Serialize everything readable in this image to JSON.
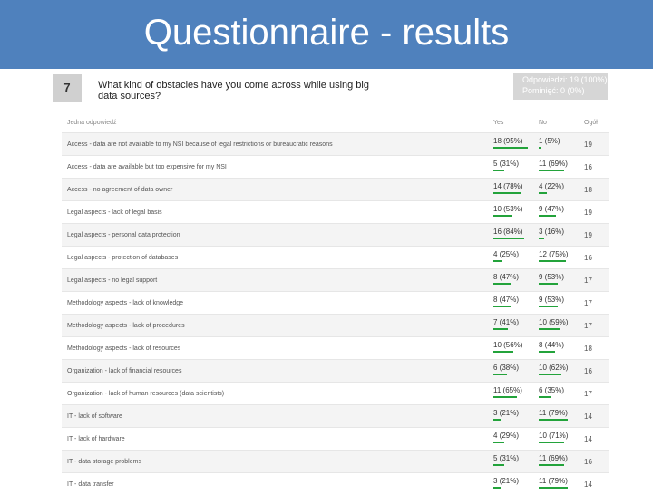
{
  "slide": {
    "title": "Questionnaire - results"
  },
  "question": {
    "number": "7",
    "text": "What kind of obstacles have you come across while using big data sources?",
    "stats_answered": "Odpowiedzi: 19 (100%)",
    "stats_skipped": "Pominięć: 0 (0%)"
  },
  "table": {
    "headers": [
      "Jedna odpowiedź",
      "Yes",
      "No",
      "Ogół"
    ],
    "rows": [
      {
        "label": "Access - data are not available to my NSI because of legal restrictions or bureaucratic reasons",
        "yes": "18 (95%)",
        "yes_frac": 0.95,
        "no": "1 (5%)",
        "no_frac": 0.05,
        "total": "19"
      },
      {
        "label": "Access - data are available but too expensive for my NSI",
        "yes": "5 (31%)",
        "yes_frac": 0.31,
        "no": "11 (69%)",
        "no_frac": 0.69,
        "total": "16"
      },
      {
        "label": "Access - no agreement of data owner",
        "yes": "14 (78%)",
        "yes_frac": 0.78,
        "no": "4 (22%)",
        "no_frac": 0.22,
        "total": "18"
      },
      {
        "label": "Legal aspects - lack of legal basis",
        "yes": "10 (53%)",
        "yes_frac": 0.53,
        "no": "9 (47%)",
        "no_frac": 0.47,
        "total": "19"
      },
      {
        "label": "Legal aspects - personal data protection",
        "yes": "16 (84%)",
        "yes_frac": 0.84,
        "no": "3 (16%)",
        "no_frac": 0.16,
        "total": "19"
      },
      {
        "label": "Legal aspects - protection of databases",
        "yes": "4 (25%)",
        "yes_frac": 0.25,
        "no": "12 (75%)",
        "no_frac": 0.75,
        "total": "16"
      },
      {
        "label": "Legal aspects - no legal support",
        "yes": "8 (47%)",
        "yes_frac": 0.47,
        "no": "9 (53%)",
        "no_frac": 0.53,
        "total": "17"
      },
      {
        "label": "Methodology aspects - lack of knowledge",
        "yes": "8 (47%)",
        "yes_frac": 0.47,
        "no": "9 (53%)",
        "no_frac": 0.53,
        "total": "17"
      },
      {
        "label": "Methodology aspects - lack of procedures",
        "yes": "7 (41%)",
        "yes_frac": 0.41,
        "no": "10 (59%)",
        "no_frac": 0.59,
        "total": "17"
      },
      {
        "label": "Methodology aspects - lack of resources",
        "yes": "10 (56%)",
        "yes_frac": 0.56,
        "no": "8 (44%)",
        "no_frac": 0.44,
        "total": "18"
      },
      {
        "label": "Organization - lack of financial resources",
        "yes": "6 (38%)",
        "yes_frac": 0.38,
        "no": "10 (62%)",
        "no_frac": 0.62,
        "total": "16"
      },
      {
        "label": "Organization - lack of human resources (data scientists)",
        "yes": "11 (65%)",
        "yes_frac": 0.65,
        "no": "6 (35%)",
        "no_frac": 0.35,
        "total": "17"
      },
      {
        "label": "IT - lack of software",
        "yes": "3 (21%)",
        "yes_frac": 0.21,
        "no": "11 (79%)",
        "no_frac": 0.79,
        "total": "14"
      },
      {
        "label": "IT - lack of hardware",
        "yes": "4 (29%)",
        "yes_frac": 0.29,
        "no": "10 (71%)",
        "no_frac": 0.71,
        "total": "14"
      },
      {
        "label": "IT - data storage problems",
        "yes": "5 (31%)",
        "yes_frac": 0.31,
        "no": "11 (69%)",
        "no_frac": 0.69,
        "total": "16"
      },
      {
        "label": "IT - data transfer",
        "yes": "3 (21%)",
        "yes_frac": 0.21,
        "no": "11 (79%)",
        "no_frac": 0.79,
        "total": "14"
      }
    ]
  },
  "colors": {
    "title_bg": "#4f81bd",
    "bar": "#23a33b"
  }
}
